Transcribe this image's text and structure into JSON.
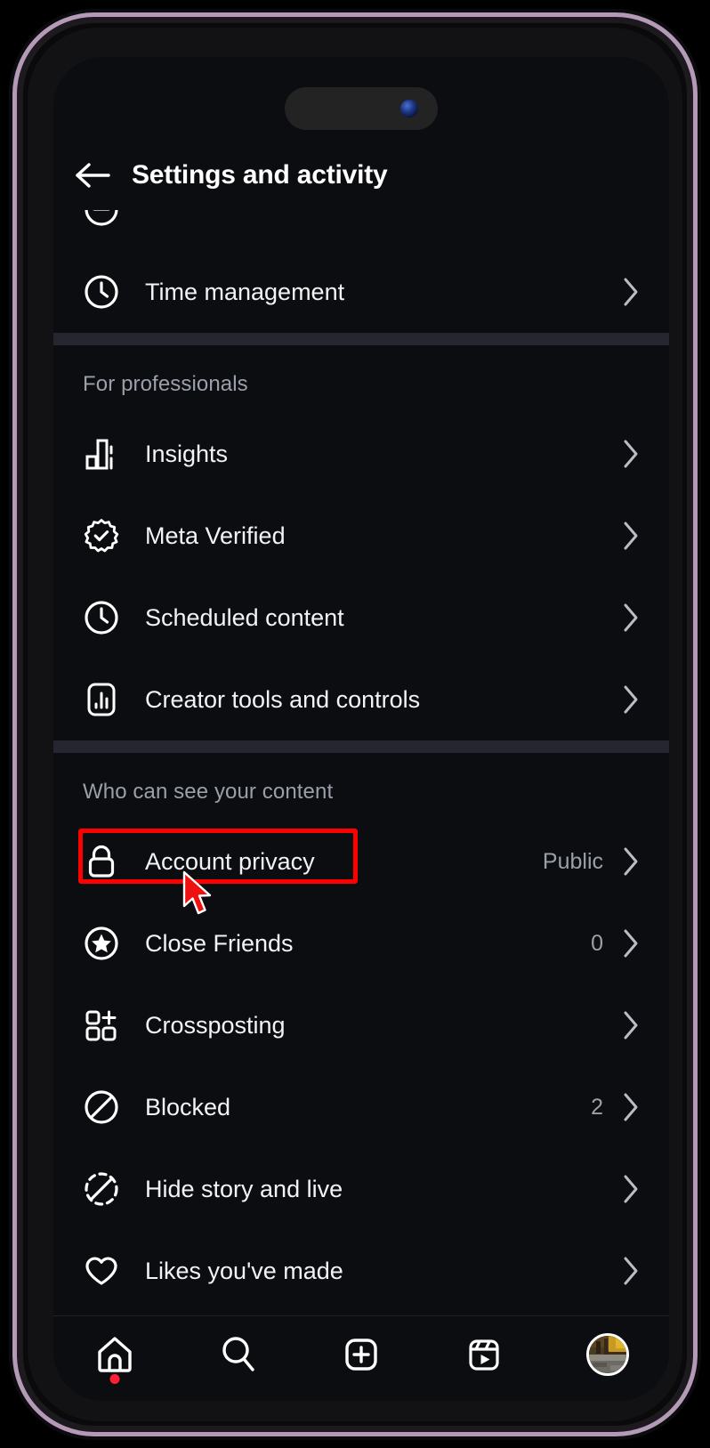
{
  "header": {
    "title": "Settings and activity",
    "back_icon": "arrow-left-icon"
  },
  "list": {
    "top_partial_row": {
      "icon": "partial-scrolled-icon"
    },
    "rows_top": [
      {
        "label": "Time management",
        "icon": "clock-icon",
        "value": "",
        "chevron": "chevron-right-icon"
      }
    ],
    "sections": [
      {
        "header": "For professionals",
        "rows": [
          {
            "label": "Insights",
            "icon": "bar-chart-icon",
            "value": "",
            "chevron": "chevron-right-icon"
          },
          {
            "label": "Meta Verified",
            "icon": "verified-badge-icon",
            "value": "",
            "chevron": "chevron-right-icon"
          },
          {
            "label": "Scheduled content",
            "icon": "clock-icon",
            "value": "",
            "chevron": "chevron-right-icon"
          },
          {
            "label": "Creator tools and controls",
            "icon": "creator-tools-icon",
            "value": "",
            "chevron": "chevron-right-icon"
          }
        ]
      },
      {
        "header": "Who can see your content",
        "rows": [
          {
            "label": "Account privacy",
            "icon": "lock-icon",
            "value": "Public",
            "chevron": "chevron-right-icon",
            "highlighted": true
          },
          {
            "label": "Close Friends",
            "icon": "star-circle-icon",
            "value": "0",
            "chevron": "chevron-right-icon"
          },
          {
            "label": "Crossposting",
            "icon": "crossposting-grid-plus-icon",
            "value": "",
            "chevron": "chevron-right-icon"
          },
          {
            "label": "Blocked",
            "icon": "block-circle-slash-icon",
            "value": "2",
            "chevron": "chevron-right-icon"
          },
          {
            "label": "Hide story and live",
            "icon": "hide-story-icon",
            "value": "",
            "chevron": "chevron-right-icon"
          },
          {
            "label": "Likes you've made",
            "icon": "heart-icon",
            "value": "",
            "chevron": "chevron-right-icon"
          }
        ]
      }
    ]
  },
  "bottom_nav": {
    "items": [
      {
        "name": "home",
        "icon": "home-icon",
        "badge": true
      },
      {
        "name": "search",
        "icon": "search-icon",
        "badge": false
      },
      {
        "name": "create",
        "icon": "plus-square-icon",
        "badge": false
      },
      {
        "name": "reels",
        "icon": "reels-icon",
        "badge": false
      },
      {
        "name": "profile",
        "icon": "avatar-icon",
        "badge": false
      }
    ]
  },
  "annotation": {
    "highlight_color": "#ff0000",
    "cursor_color": "#ee1111",
    "target_row": "Account privacy"
  },
  "colors": {
    "screen_background": "#0c0d10",
    "divider": "#262630",
    "primary_text": "#f2f3f5",
    "secondary_text": "#9aa0a9",
    "badge_red": "#ff1f35",
    "frame": "#b49ab6"
  }
}
